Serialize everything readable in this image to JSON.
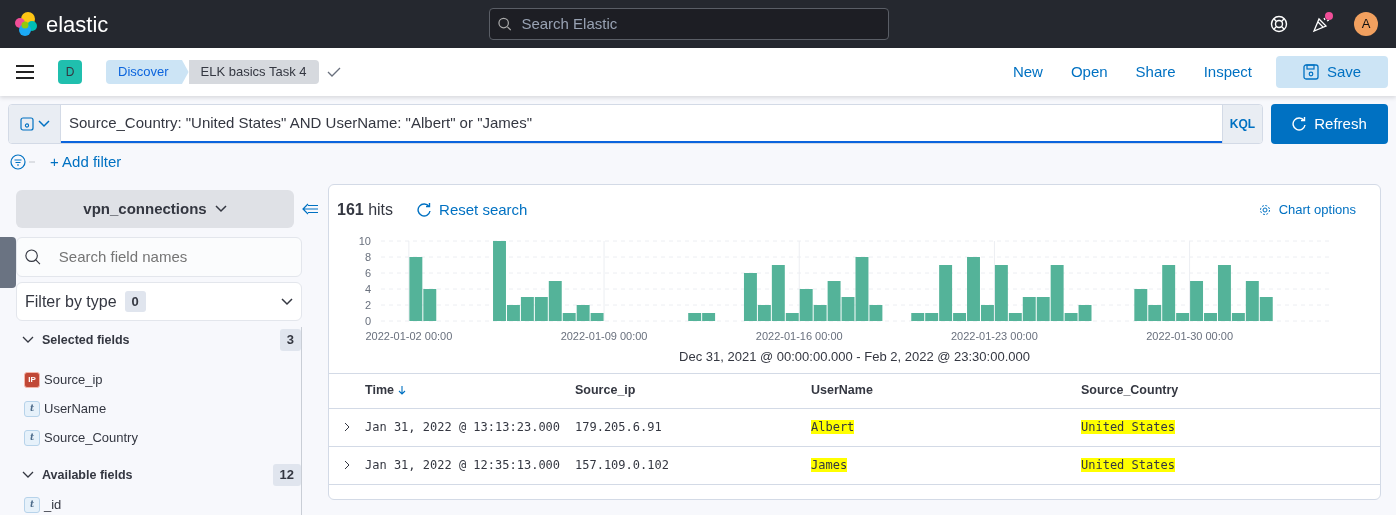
{
  "header": {
    "logo_text": "elastic",
    "search_placeholder": "Search Elastic",
    "avatar": "A",
    "notification": true
  },
  "app_bar": {
    "space": "D",
    "breadcrumbs": [
      {
        "label": "Discover",
        "selected": true
      },
      {
        "label": "ELK basics Task 4",
        "selected": false
      }
    ],
    "actions": [
      "New",
      "Open",
      "Share",
      "Inspect"
    ],
    "save": "Save"
  },
  "query": {
    "value": "Source_Country: \"United States\" AND UserName: \"Albert\" or \"James\"",
    "language": "KQL",
    "refresh": "Refresh"
  },
  "add_filter": "+ Add filter",
  "sidebar": {
    "index_pattern": "vpn_connections",
    "search_placeholder": "Search field names",
    "filter_label": "Filter by type",
    "filter_count": "0",
    "sections": [
      {
        "title": "Selected fields",
        "count": "3",
        "expanded": true,
        "fields": [
          {
            "name": "Source_ip",
            "kind": "ip",
            "glyph": "IP"
          },
          {
            "name": "UserName",
            "kind": "string",
            "glyph": "t"
          },
          {
            "name": "Source_Country",
            "kind": "string",
            "glyph": "t"
          }
        ]
      },
      {
        "title": "Available fields",
        "count": "12",
        "expanded": true,
        "fields": [
          {
            "name": "_id",
            "kind": "string",
            "glyph": "t"
          }
        ]
      }
    ]
  },
  "results": {
    "hits": "**161** hits",
    "reset": "Reset search",
    "chart_options": "Chart options",
    "chart_data": {
      "type": "bar",
      "grid": true,
      "categories": [
        null,
        null,
        "2022-01-02 00:00",
        null,
        null,
        null,
        null,
        null,
        null,
        null,
        null,
        null,
        null,
        null,
        null,
        null,
        "2022-01-09 00:00",
        null,
        null,
        null,
        null,
        null,
        null,
        null,
        null,
        null,
        null,
        null,
        null,
        null,
        "2022-01-16 00:00",
        null,
        null,
        null,
        null,
        null,
        null,
        null,
        null,
        null,
        null,
        null,
        null,
        null,
        "2022-01-23 00:00",
        null,
        null,
        null,
        null,
        null,
        null,
        null,
        null,
        null,
        null,
        null,
        null,
        null,
        "2022-01-30 00:00",
        null,
        null,
        null,
        null,
        null,
        null,
        null,
        null,
        null
      ],
      "ylim": [
        0,
        10
      ],
      "yticks": [
        0,
        2,
        4,
        6,
        8,
        10
      ],
      "series": [
        {
          "color": "#54b399",
          "values": [
            0,
            0,
            8,
            4,
            0,
            0,
            0,
            0,
            10,
            2,
            3,
            3,
            5,
            1,
            2,
            1,
            0,
            0,
            0,
            0,
            0,
            0,
            1,
            1,
            0,
            0,
            6,
            2,
            7,
            1,
            4,
            2,
            5,
            3,
            8,
            2,
            0,
            0,
            1,
            1,
            7,
            1,
            8,
            2,
            7,
            1,
            3,
            3,
            7,
            1,
            2,
            0,
            0,
            0,
            4,
            2,
            7,
            1,
            5,
            1,
            7,
            1,
            5,
            3,
            0,
            0,
            0,
            0
          ]
        }
      ]
    },
    "time_range": "Dec 31, 2021 @ 00:00:00.000 - Feb 2, 2022 @ 23:30:00.000",
    "table": {
      "columns": [
        {
          "label": "Time",
          "sorted": true
        },
        {
          "label": "Source_ip",
          "sorted": false
        },
        {
          "label": "UserName",
          "sorted": false
        },
        {
          "label": "Source_Country",
          "sorted": false
        }
      ],
      "rows": [
        {
          "expanded": false,
          "cells": [
            {
              "text": "Jan 31, 2022 @ 13:13:23.000",
              "highlighted": false
            },
            {
              "text": "179.205.6.91",
              "highlighted": false
            },
            {
              "text": "Albert",
              "highlighted": true
            },
            {
              "text": "United States",
              "highlighted": true
            }
          ]
        },
        {
          "expanded": false,
          "cells": [
            {
              "text": "Jan 31, 2022 @ 12:35:13.000",
              "highlighted": false
            },
            {
              "text": "157.109.0.102",
              "highlighted": false
            },
            {
              "text": "James",
              "highlighted": true
            },
            {
              "text": "United States",
              "highlighted": true
            }
          ]
        }
      ]
    }
  }
}
